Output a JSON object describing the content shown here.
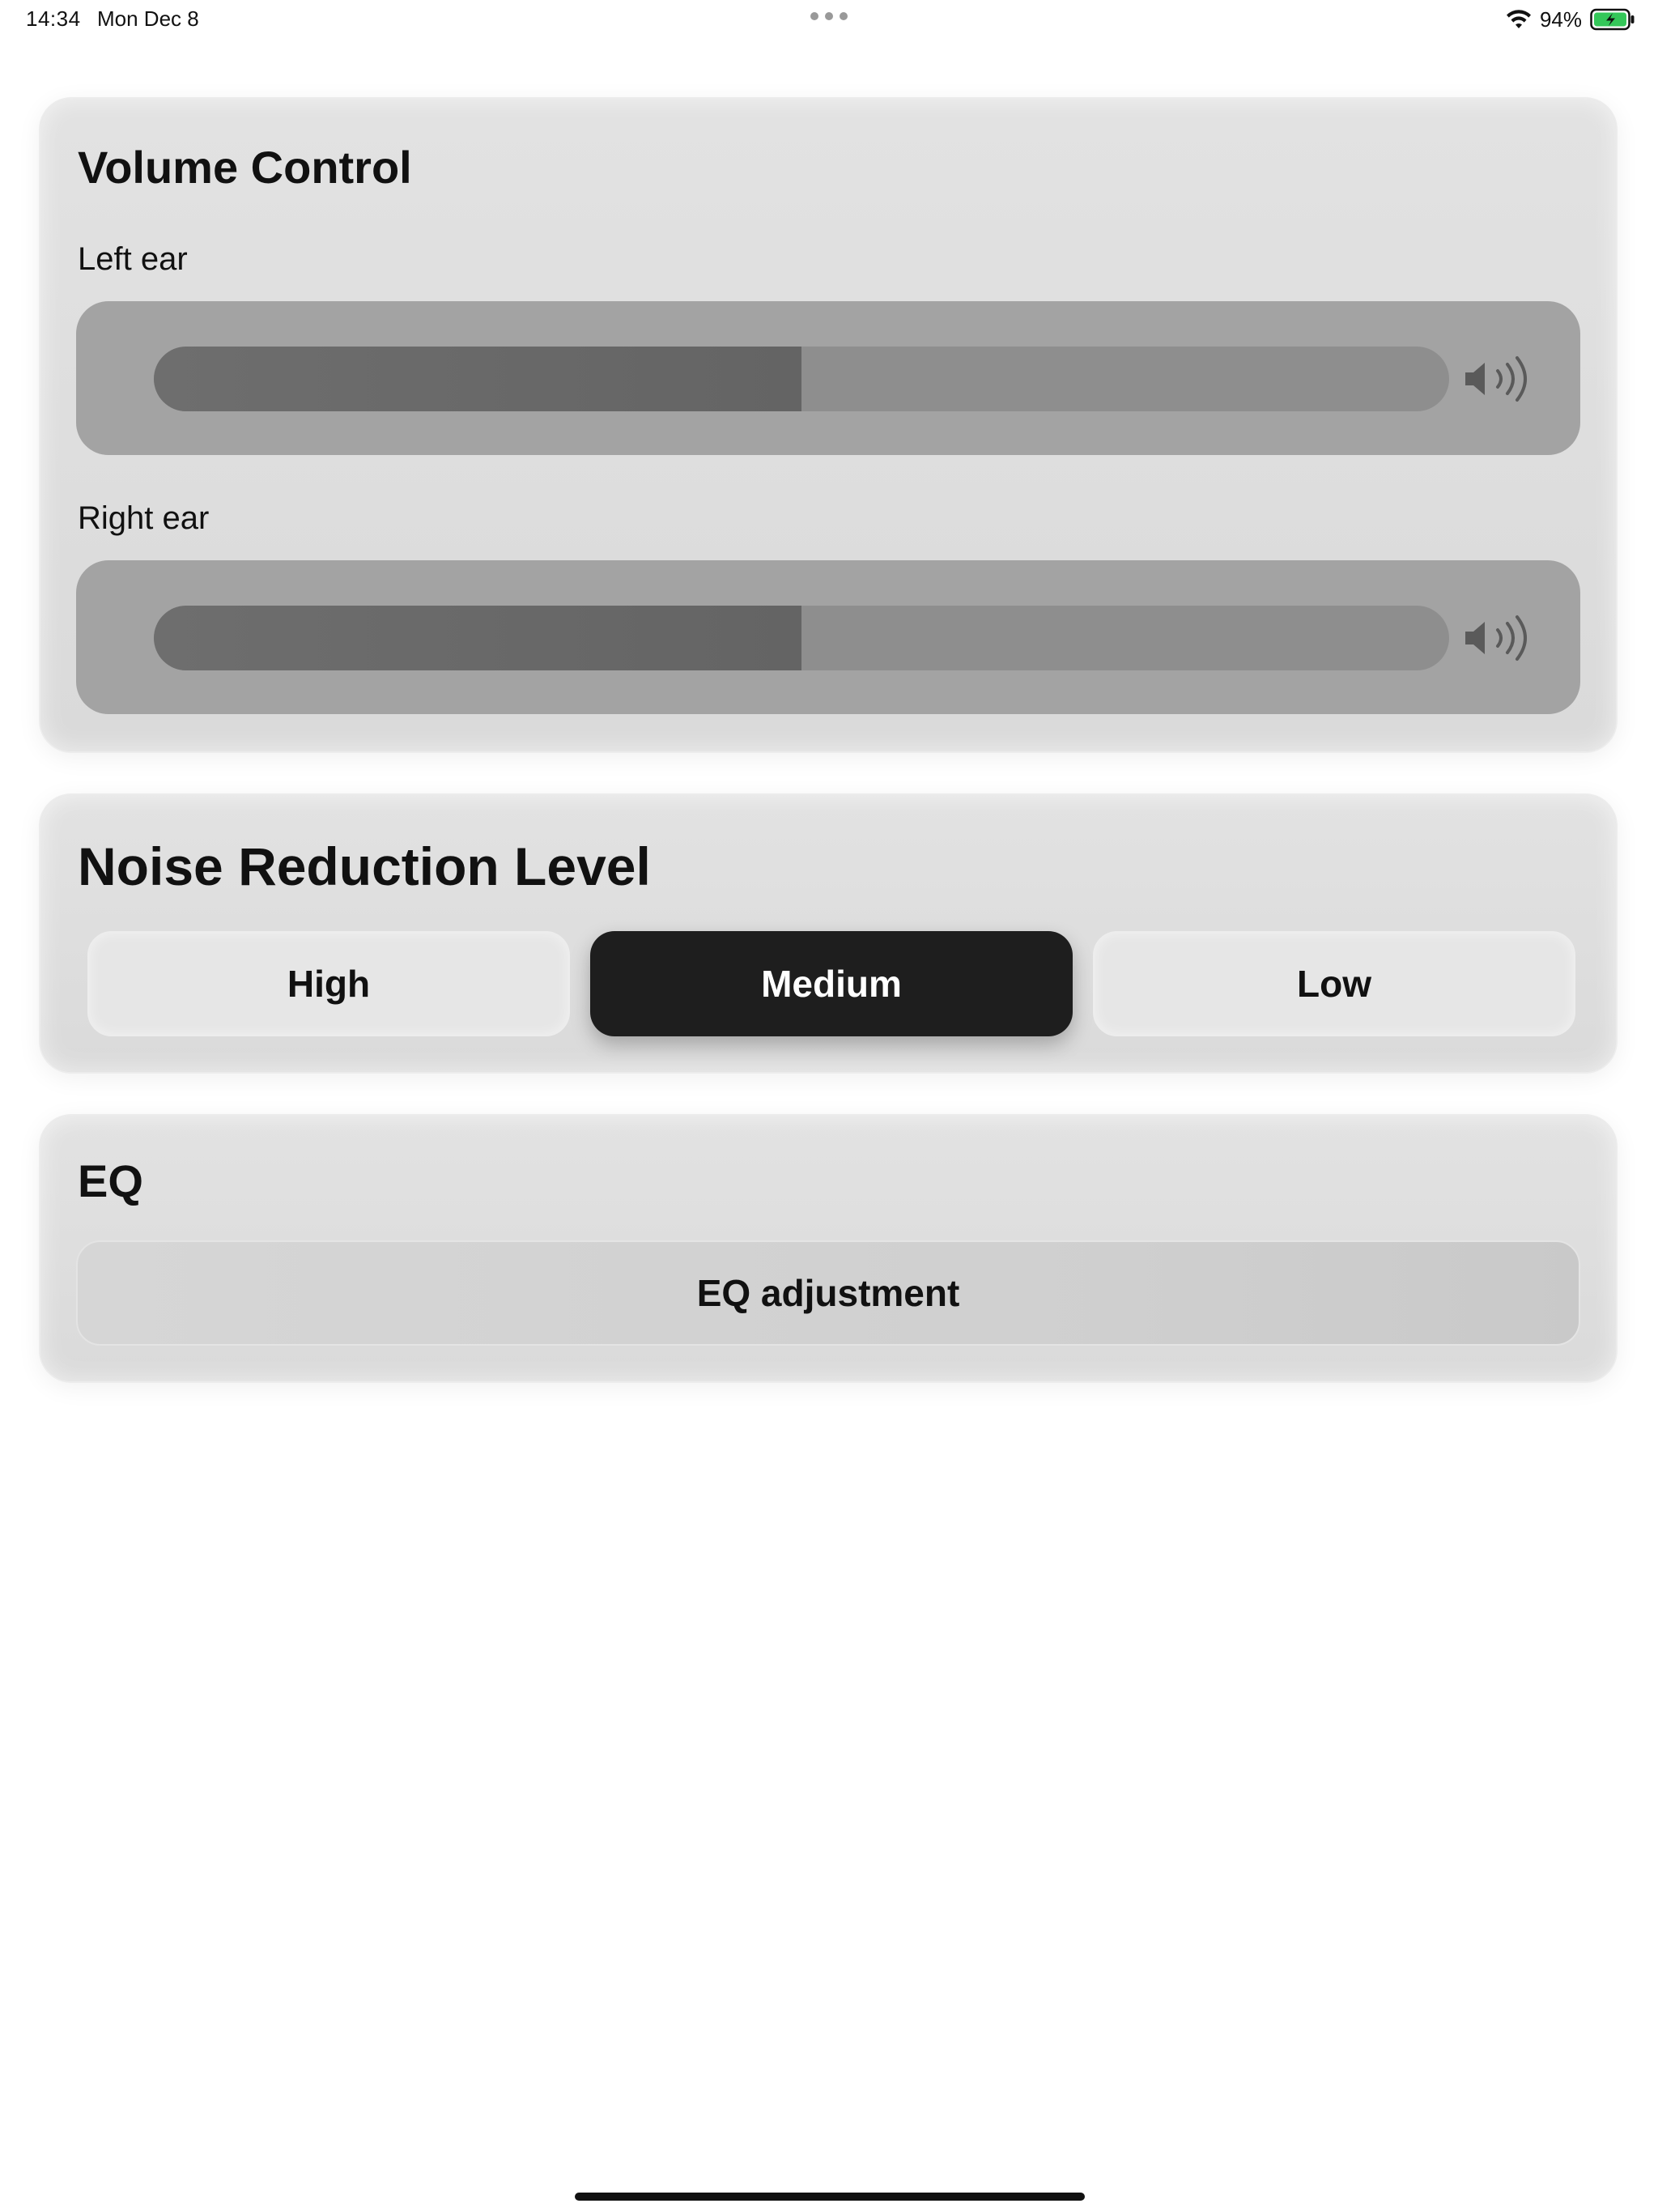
{
  "status_bar": {
    "time": "14:34",
    "date": "Mon Dec 8",
    "battery_percent": "94%",
    "icons": [
      "more-dots-icon",
      "wifi-icon",
      "battery-charging-icon"
    ],
    "battery_color": "#34c759"
  },
  "volume_control": {
    "title": "Volume Control",
    "left_ear": {
      "label": "Left ear",
      "level": 0.5,
      "icon": "speaker-volume-icon"
    },
    "right_ear": {
      "label": "Right ear",
      "level": 0.5,
      "icon": "speaker-volume-icon"
    }
  },
  "noise_reduction": {
    "title": "Noise Reduction Level",
    "options": [
      "High",
      "Medium",
      "Low"
    ],
    "selected": "Medium"
  },
  "eq": {
    "title": "EQ",
    "button_label": "EQ adjustment"
  },
  "colors": {
    "accent_dark": "#1e1e1e",
    "slider_fill": "#666666",
    "slider_track": "#8e8e8e",
    "panel": "#a3a3a3"
  }
}
